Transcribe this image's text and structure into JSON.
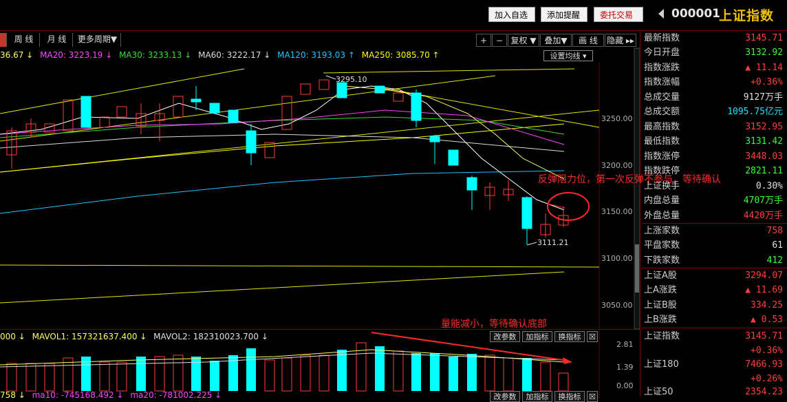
{
  "topbar": {
    "add_watch": "加入自选",
    "add_alert": "添加提醒",
    "trade": "委托交易",
    "code": "000001",
    "name": "上证指数"
  },
  "periods": [
    "周 线",
    "月 线",
    "更多周期▼"
  ],
  "chart_toolbar": [
    "+",
    "−",
    "复权 ▼",
    "叠加▼",
    "画 线",
    "隐藏 ▸▸"
  ],
  "ma_legend": {
    "ma10_partial": "36.67 ↓",
    "ma20": "MA20: 3223.19 ↓",
    "ma30": "MA30: 3233.13 ↓",
    "ma60": "MA60: 3222.17 ↓",
    "ma120": "MA120: 3193.03 ↑",
    "ma250": "MA250: 3085.70 ↑",
    "set_ma": "设置均线 ▾"
  },
  "colors": {
    "ma10": "#ffff66",
    "ma20": "#ff44ff",
    "ma30": "#33dd33",
    "ma60": "#dddddd",
    "ma120": "#22c4ff",
    "ma250": "#ffff00",
    "up": "#ff3c3c",
    "down": "#00ffff"
  },
  "chart_data": {
    "type": "candlestick",
    "y_ticks": [
      "3250.00",
      "3200.00",
      "3150.00",
      "3100.00",
      "3050.00"
    ],
    "high_marker": "3295.10",
    "low_marker": "3111.21",
    "volume": {
      "ticks": [
        "2.81",
        "1.39",
        "0.00"
      ],
      "legend": {
        "partial": "000 ↓",
        "mavol1": "MAVOL1: 157321637.400 ↓",
        "mavol2": "MAVOL2: 182310023.700 ↓"
      }
    }
  },
  "annotations": {
    "resistance": "反弹阻力位，第一次反弹不参与，等待确认",
    "volume": "量能减小，等待确认底部"
  },
  "vol_buttons": [
    "改参数",
    "加指标",
    "换指标",
    "☒"
  ],
  "bottom_legend": {
    "a": "758 ↓",
    "b": "ma10: -745168.492 ↓",
    "c": "ma20: -781002.225 ↓"
  },
  "right_panel": [
    {
      "label": "最新指数",
      "value": "3145.71",
      "color": "#ff4040"
    },
    {
      "label": "今日开盘",
      "value": "3132.92",
      "color": "#33ff33"
    },
    {
      "label": "指数涨跌",
      "value": "▲ 11.14",
      "color": "#ff4040"
    },
    {
      "label": "指数涨幅",
      "value": "+0.36%",
      "color": "#ff4040"
    },
    {
      "label": "总成交量",
      "value": "9127万手",
      "color": "#e0e0e0"
    },
    {
      "label": "总成交额",
      "value": "1095.75亿元",
      "color": "#22e0ff"
    },
    {
      "label": "最高指数",
      "value": "3152.95",
      "color": "#ff4040"
    },
    {
      "label": "最低指数",
      "value": "3131.42",
      "color": "#33ff33"
    },
    {
      "label": "指数涨停",
      "value": "3448.03",
      "color": "#ff4040"
    },
    {
      "label": "指数跌停",
      "value": "2821.11",
      "color": "#33ff33"
    },
    {
      "label": "上证换手",
      "value": "0.30%",
      "color": "#e0e0e0"
    },
    {
      "label": "内盘总量",
      "value": "4707万手",
      "color": "#33ff33"
    },
    {
      "label": "外盘总量",
      "value": "4420万手",
      "color": "#ff4040"
    },
    {
      "label": "上涨家数",
      "value": "758",
      "color": "#ff4040"
    },
    {
      "label": "平盘家数",
      "value": "61",
      "color": "#e0e0e0"
    },
    {
      "label": "下跌家数",
      "value": "412",
      "color": "#33ff33"
    },
    {
      "label": "上证A股",
      "value": "3294.07",
      "color": "#ff4040"
    },
    {
      "label": "上A涨跌",
      "value": "▲ 11.69",
      "color": "#ff4040"
    },
    {
      "label": "上证B股",
      "value": "334.25",
      "color": "#ff4040"
    },
    {
      "label": "上B涨跌",
      "value": "▲ 0.53",
      "color": "#ff4040"
    },
    {
      "label": "上证指数",
      "value": "3145.71",
      "color": "#ff4040"
    },
    {
      "label": "",
      "value": "+0.36%",
      "color": "#ff4040"
    },
    {
      "label": "上证180",
      "value": "7466.93",
      "color": "#ff4040"
    },
    {
      "label": "",
      "value": "+0.26%",
      "color": "#ff4040"
    },
    {
      "label": "上证50",
      "value": "2354.23",
      "color": "#ff4040"
    }
  ]
}
